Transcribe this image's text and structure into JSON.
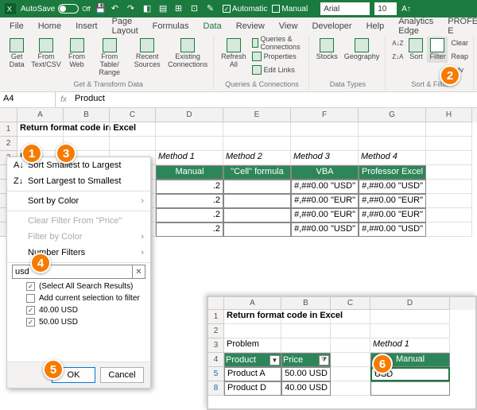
{
  "titlebar": {
    "autosave_label": "AutoSave",
    "autosave_state": "Off",
    "automatic_label": "Automatic",
    "manual_label": "Manual",
    "font_name": "Arial",
    "font_size": "10"
  },
  "menu": {
    "file": "File",
    "home": "Home",
    "insert": "Insert",
    "page_layout": "Page Layout",
    "formulas": "Formulas",
    "data": "Data",
    "review": "Review",
    "view": "View",
    "developer": "Developer",
    "help": "Help",
    "analytics": "Analytics Edge",
    "professor": "PROFESSOR E"
  },
  "ribbon": {
    "group1": {
      "label": "Get & Transform Data",
      "b1": "Get Data",
      "b2": "From Text/CSV",
      "b3": "From Web",
      "b4": "From Table/ Range",
      "b5": "Recent Sources",
      "b6": "Existing Connections"
    },
    "group2": {
      "label": "Queries & Connections",
      "b1": "Refresh All",
      "l1": "Queries & Connections",
      "l2": "Properties",
      "l3": "Edit Links"
    },
    "group3": {
      "label": "Data Types",
      "b1": "Stocks",
      "b2": "Geography"
    },
    "group4": {
      "label": "Sort & Filter",
      "b1": "Sort",
      "b2": "Filter",
      "l1": "Clear",
      "l2": "Reap",
      "l3": "Adv"
    }
  },
  "namebox": "A4",
  "formulabar": "Product",
  "cols": [
    "A",
    "B",
    "C",
    "D",
    "E",
    "F",
    "G",
    "H"
  ],
  "sheet": {
    "title": "Return format code in Excel",
    "r3a": "Pr",
    "methods": {
      "m1": "Method 1",
      "m2": "Method 2",
      "m3": "Method 3",
      "m4": "Method 4"
    },
    "hdrs": {
      "product": "Product",
      "price": "Price",
      "d": "Manual",
      "e": "\"Cell\" formula",
      "f": "VBA",
      "g": "Professor Excel"
    },
    "rows": [
      {
        "d": ".2",
        "f": "#,##0.00 \"USD\"",
        "g": "#,##0.00 \"USD\""
      },
      {
        "d": ".2",
        "f": "#,##0.00 \"EUR\"",
        "g": "#,##0.00 \"EUR\""
      },
      {
        "d": ".2",
        "f": "#,##0.00 \"EUR\"",
        "g": "#,##0.00 \"EUR\""
      },
      {
        "d": ".2",
        "f": "#,##0.00 \"USD\"",
        "g": "#,##0.00 \"USD\""
      }
    ]
  },
  "filter_menu": {
    "s_asc": "Sort Smallest to Largest",
    "s_desc": "Sort Largest to Smallest",
    "s_color": "Sort by Color",
    "clear": "Clear Filter From \"Price\"",
    "f_color": "Filter by Color",
    "f_num": "Number Filters",
    "search_value": "usd",
    "chk_all": "(Select All Search Results)",
    "chk_add": "Add current selection to filter",
    "chk_v1": "40.00 USD",
    "chk_v2": "50.00 USD",
    "ok": "OK",
    "cancel": "Cancel"
  },
  "inset": {
    "cols": [
      "A",
      "B",
      "C",
      "D"
    ],
    "title": "Return format code in Excel",
    "problem": "Problem",
    "m1": "Method 1",
    "hprod": "Product",
    "hprice": "Price",
    "hman": "Manual",
    "r5": {
      "num": "5",
      "a": "Product A",
      "b": "50.00 USD"
    },
    "r8": {
      "num": "8",
      "a": "Product D",
      "b": "40.00 USD"
    },
    "d5": "USD"
  },
  "badges": {
    "b1": "1",
    "b2": "2",
    "b3": "3",
    "b4": "4",
    "b5": "5",
    "b6": "6"
  }
}
